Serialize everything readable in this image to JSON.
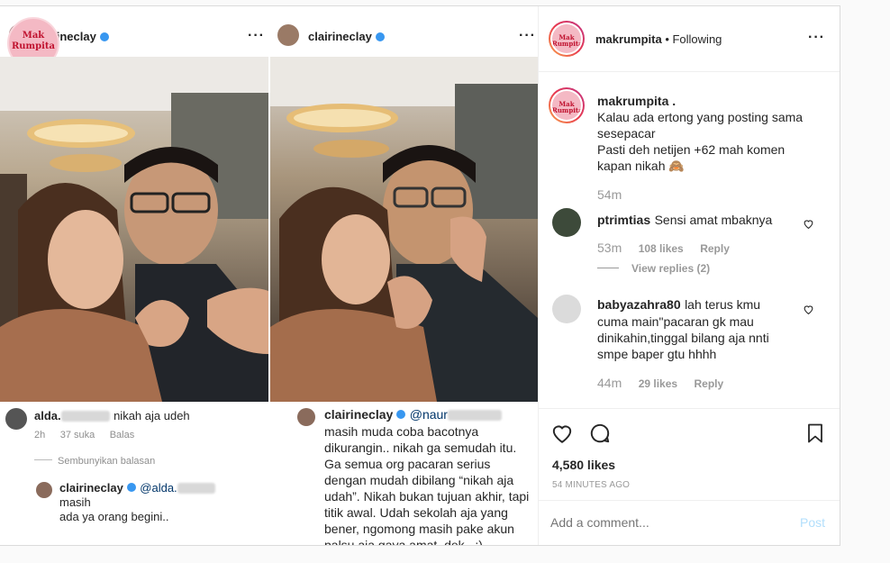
{
  "colors": {
    "accent": "#3897f0",
    "brand_pink": "#f4b9c4",
    "brand_red": "#c0122f"
  },
  "left_shot": {
    "logo_text_top": "Mak",
    "logo_text_bottom": "Rumpita",
    "username": "clairineclay",
    "comment1_user": "alda.",
    "comment1_text": "nikah aja udeh",
    "comment1_time": "2h",
    "comment1_likes": "37 suka",
    "comment1_reply": "Balas",
    "hide_replies": "Sembunyikan balasan",
    "reply_user": "clairineclay",
    "reply_mention": "@alda.",
    "reply_text_a": "masih",
    "reply_text_b": "ada ya orang begini.."
  },
  "right_shot": {
    "username": "clairineclay",
    "comment_user": "clairineclay",
    "comment_mention": "@naur",
    "comment_text": "masih muda coba bacotnya dikurangin.. nikah ga semudah itu. Ga semua org pacaran serius dengan mudah dibilang “nikah aja udah”. Nikah bukan tujuan akhir, tapi titik awal. Udah sekolah aja yang bener, ngomong masih pake akun palsu aja gaya amat, dek.. :)"
  },
  "panel": {
    "header_user": "makrumpita",
    "header_sep": " • ",
    "header_follow": "Following",
    "caption_user": "makrumpita .",
    "caption_lines": [
      "Kalau ada ertong yang posting sama",
      "sesepacar",
      "Pasti deh netijen +62 mah komen",
      "kapan nikah 🙈"
    ],
    "caption_time": "54m",
    "comments": [
      {
        "user": "ptrimtias",
        "text": "Sensi amat mbaknya",
        "time": "53m",
        "likes": "108 likes",
        "reply": "Reply",
        "view_replies": "View replies (2)"
      },
      {
        "user": "babyazahra80",
        "text_lines": [
          "lah terus kmu",
          "cuma main\"pacaran gk mau",
          "dinikahin,tinggal bilang aja nnti",
          "smpe baper gtu hhhh"
        ],
        "time": "44m",
        "likes": "29 likes",
        "reply": "Reply"
      }
    ],
    "likes": "4,580 likes",
    "posted": "54 MINUTES AGO",
    "add_comment_placeholder": "Add a comment...",
    "post_button": "Post"
  }
}
